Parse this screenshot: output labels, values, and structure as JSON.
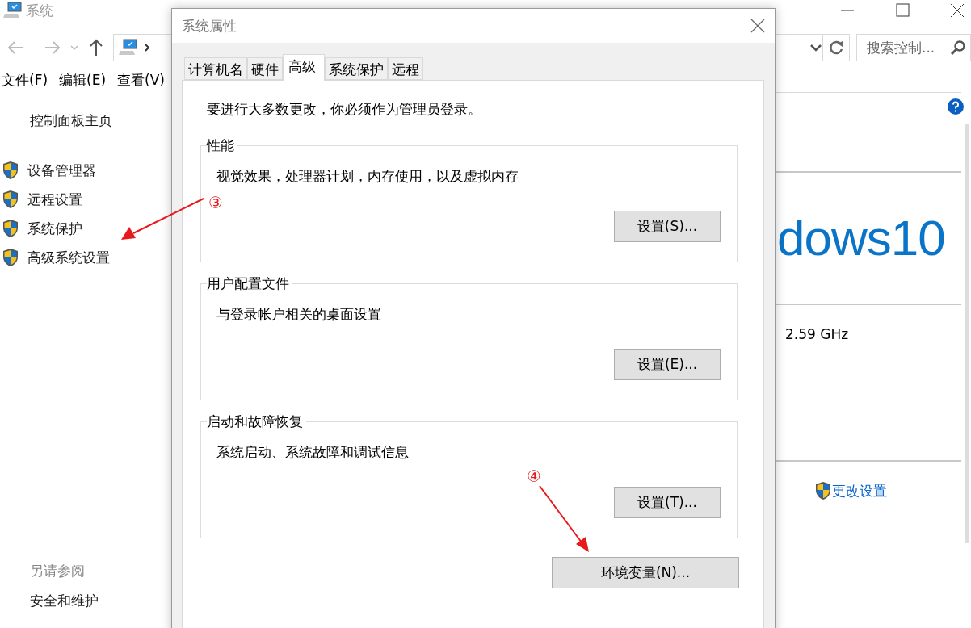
{
  "window": {
    "title": "系统"
  },
  "menu": [
    "文件(F)",
    "编辑(E)",
    "查看(V)"
  ],
  "search": {
    "placeholder": "搜索控制..."
  },
  "sidebar": {
    "home": "控制面板主页",
    "items": [
      {
        "label": "设备管理器"
      },
      {
        "label": "远程设置"
      },
      {
        "label": "系统保护"
      },
      {
        "label": "高级系统设置"
      }
    ],
    "see_also": {
      "heading": "另请参阅",
      "items": [
        "安全和维护"
      ]
    }
  },
  "content": {
    "edition": "dows10",
    "cpu_speed": "2.59 GHz",
    "change_settings": "更改设置"
  },
  "dialog": {
    "title": "系统属性",
    "tabs": [
      {
        "label": "计算机名",
        "selected": false
      },
      {
        "label": "硬件",
        "selected": false
      },
      {
        "label": "高级",
        "selected": true
      },
      {
        "label": "系统保护",
        "selected": false
      },
      {
        "label": "远程",
        "selected": false
      }
    ],
    "admin_note": "要进行大多数更改，你必须作为管理员登录。",
    "groups": [
      {
        "title": "性能",
        "description": "视觉效果，处理器计划，内存使用，以及虚拟内存",
        "button": "设置(S)..."
      },
      {
        "title": "用户配置文件",
        "description": "与登录帐户相关的桌面设置",
        "button": "设置(E)..."
      },
      {
        "title": "启动和故障恢复",
        "description": "系统启动、系统故障和调试信息",
        "button": "设置(T)..."
      }
    ],
    "env_button": "环境变量(N)..."
  },
  "annotations": [
    {
      "label": "③"
    },
    {
      "label": "④"
    }
  ]
}
